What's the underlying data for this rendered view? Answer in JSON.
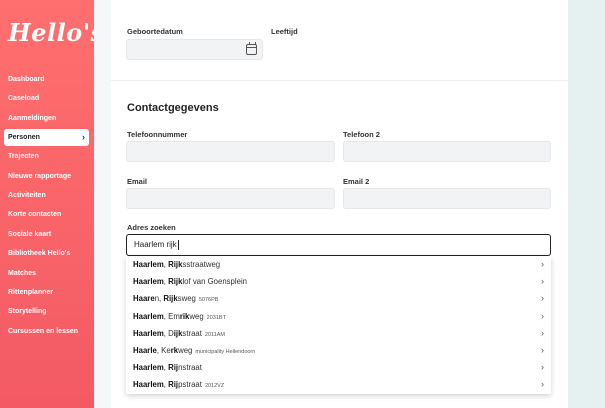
{
  "app": {
    "logo_text": "Hello's"
  },
  "sidebar": {
    "items": [
      {
        "label": "Dashboard"
      },
      {
        "label": "Caseload"
      },
      {
        "label": "Aanmeldingen"
      },
      {
        "label": "Personen",
        "active": true
      },
      {
        "label": "Trajecten"
      },
      {
        "label": "Nieuwe rapportage"
      },
      {
        "label": "Activiteiten"
      },
      {
        "label": "Korte contacten"
      },
      {
        "label": "Sociale kaart"
      },
      {
        "label": "Bibliotheek Hello's"
      },
      {
        "label": "Matches"
      },
      {
        "label": "Rittenplanner"
      },
      {
        "label": "Storytelling"
      },
      {
        "label": "Cursussen en lessen"
      }
    ]
  },
  "form": {
    "birthdate_label": "Geboortedatum",
    "age_label": "Leeftijd",
    "contact_title": "Contactgegevens",
    "phone_label": "Telefoonnummer",
    "phone2_label": "Telefoon 2",
    "email_label": "Email",
    "email2_label": "Email 2",
    "address_search_label": "Adres zoeken",
    "address_search_value": "Haarlem rijk"
  },
  "suggestions": [
    {
      "parts": [
        [
          "b",
          "Haarlem"
        ],
        [
          "t",
          ", "
        ],
        [
          "b",
          "Rijk"
        ],
        [
          "t",
          "sstraatweg"
        ]
      ],
      "extra": ""
    },
    {
      "parts": [
        [
          "b",
          "Haarlem"
        ],
        [
          "t",
          ", "
        ],
        [
          "b",
          "Rijk"
        ],
        [
          "t",
          "lof van Goensplein"
        ]
      ],
      "extra": ""
    },
    {
      "parts": [
        [
          "b",
          "Haare"
        ],
        [
          "t",
          "n, "
        ],
        [
          "b",
          "Rijk"
        ],
        [
          "t",
          "sweg"
        ]
      ],
      "extra": "5076PB"
    },
    {
      "parts": [
        [
          "b",
          "Haarlem"
        ],
        [
          "t",
          ", Em"
        ],
        [
          "b",
          "rik"
        ],
        [
          "t",
          "weg"
        ]
      ],
      "extra": "2031BT"
    },
    {
      "parts": [
        [
          "b",
          "Haarlem"
        ],
        [
          "t",
          ", D"
        ],
        [
          "b",
          "ijk"
        ],
        [
          "t",
          "straat"
        ]
      ],
      "extra": "2011AM"
    },
    {
      "parts": [
        [
          "b",
          "Haarle"
        ],
        [
          "t",
          ", Ke"
        ],
        [
          "b",
          "rk"
        ],
        [
          "t",
          "weg"
        ]
      ],
      "extra": "municipality Heilendoorn"
    },
    {
      "parts": [
        [
          "b",
          "Haarlem"
        ],
        [
          "t",
          ", "
        ],
        [
          "b",
          "Rij"
        ],
        [
          "t",
          "nstraat"
        ]
      ],
      "extra": ""
    },
    {
      "parts": [
        [
          "b",
          "Haarlem"
        ],
        [
          "t",
          ", "
        ],
        [
          "b",
          "Rij"
        ],
        [
          "t",
          "pstraat"
        ]
      ],
      "extra": "2012VZ"
    }
  ],
  "icons": {
    "calendar": "calendar-icon",
    "chevron": "chevron-right-icon"
  },
  "colors": {
    "sidebar": "#f35a64",
    "accent": "#ff6f6f"
  }
}
